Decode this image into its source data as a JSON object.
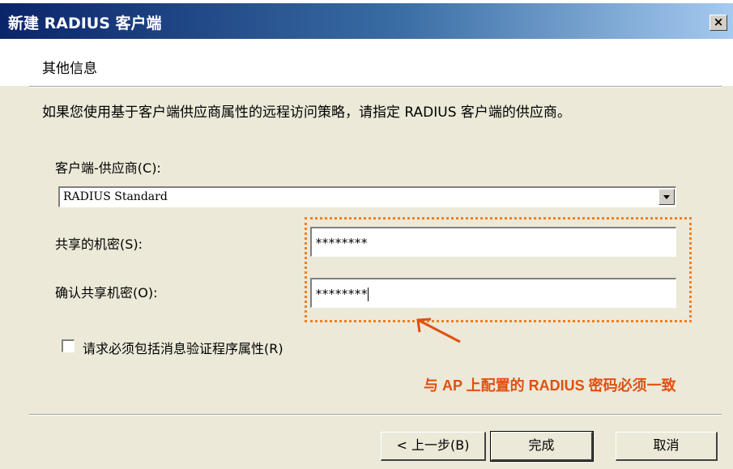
{
  "window": {
    "title": "新建 RADIUS 客户端",
    "close": "×"
  },
  "header": {
    "title": "其他信息"
  },
  "description": "如果您使用基于客户端供应商属性的远程访问策略，请指定 RADIUS 客户端的供应商。",
  "vendor": {
    "label": "客户端-供应商(C):",
    "value": "RADIUS Standard"
  },
  "shared_secret": {
    "label": "共享的机密(S):",
    "value": "********"
  },
  "confirm_secret": {
    "label": "确认共享机密(O):",
    "value": "********"
  },
  "checkbox": {
    "label": "请求必须包括消息验证程序属性(R)",
    "checked": false
  },
  "annotation": {
    "text": "与 AP 上配置的 RADIUS 密码必须一致",
    "color": "#e05010"
  },
  "buttons": {
    "back": "< 上一步(B)",
    "finish": "完成",
    "cancel": "取消"
  }
}
